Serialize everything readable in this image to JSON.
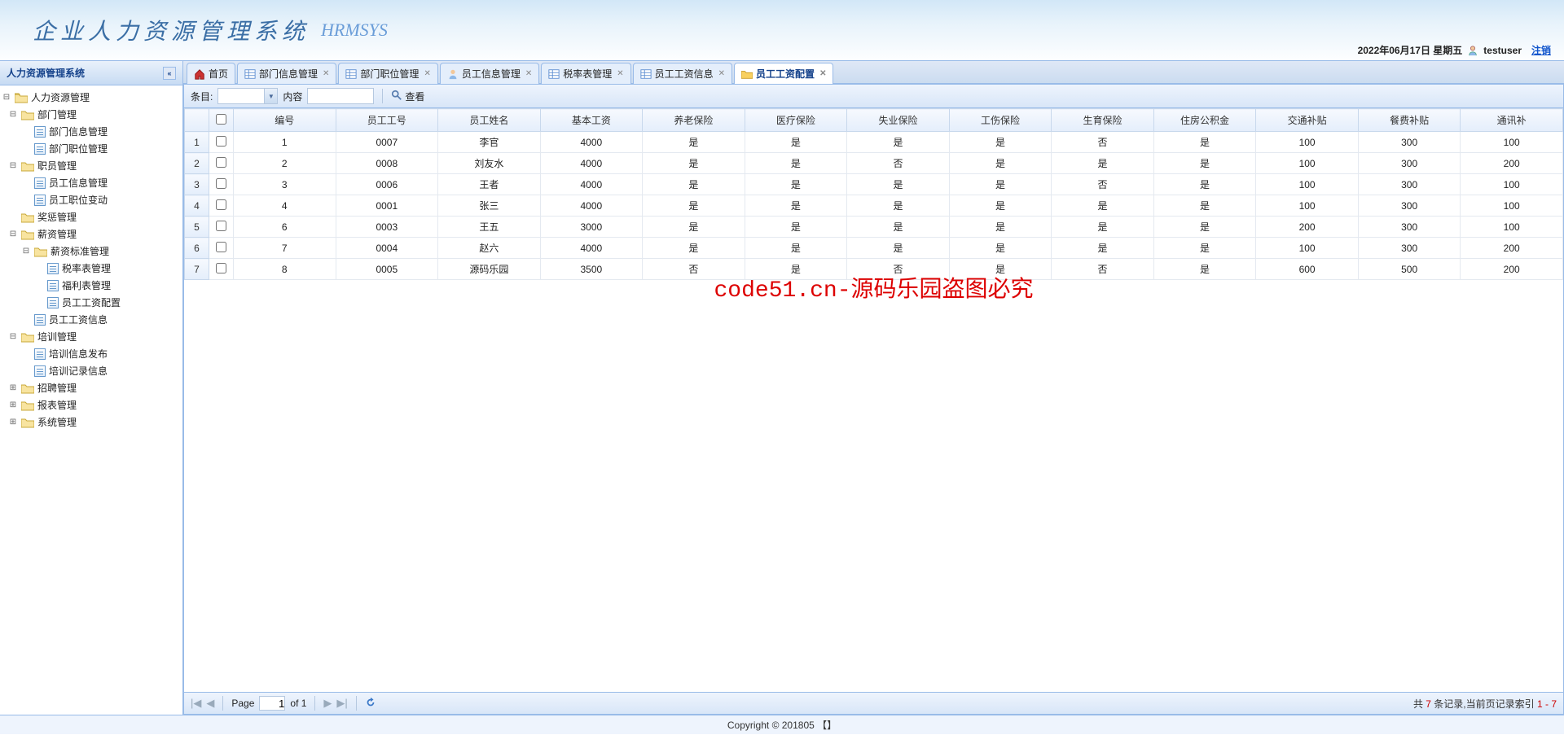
{
  "header": {
    "title": "企业人力资源管理系统",
    "subtitle": "HRMSYS",
    "date_text": "2022年06月17日 星期五",
    "user": "testuser",
    "logout": "注销"
  },
  "sidebar": {
    "title": "人力资源管理系统",
    "root": "人力资源管理",
    "nodes": {
      "dept_mgmt": "部门管理",
      "dept_info": "部门信息管理",
      "dept_pos": "部门职位管理",
      "emp_mgmt": "职员管理",
      "emp_info": "员工信息管理",
      "emp_pos_change": "员工职位变动",
      "reward": "奖惩管理",
      "salary_mgmt": "薪资管理",
      "salary_std": "薪资标准管理",
      "tax_table": "税率表管理",
      "welfare_table": "福利表管理",
      "salary_config": "员工工资配置",
      "salary_info": "员工工资信息",
      "train_mgmt": "培训管理",
      "train_pub": "培训信息发布",
      "train_rec": "培训记录信息",
      "recruit": "招聘管理",
      "report": "报表管理",
      "system": "系统管理"
    }
  },
  "tabs": [
    {
      "label": "首页",
      "icon": "home",
      "closable": false
    },
    {
      "label": "部门信息管理",
      "icon": "grid",
      "closable": true
    },
    {
      "label": "部门职位管理",
      "icon": "grid",
      "closable": true
    },
    {
      "label": "员工信息管理",
      "icon": "person",
      "closable": true
    },
    {
      "label": "税率表管理",
      "icon": "grid",
      "closable": true
    },
    {
      "label": "员工工资信息",
      "icon": "grid",
      "closable": true
    },
    {
      "label": "员工工资配置",
      "icon": "folder",
      "closable": true,
      "active": true
    }
  ],
  "toolbar": {
    "item_label": "条目:",
    "content_label": "内容",
    "view_label": "查看"
  },
  "grid": {
    "columns": [
      "编号",
      "员工工号",
      "员工姓名",
      "基本工资",
      "养老保险",
      "医疗保险",
      "失业保险",
      "工伤保险",
      "生育保险",
      "住房公积金",
      "交通补贴",
      "餐费补贴",
      "通讯补"
    ],
    "rows": [
      {
        "n": "1",
        "id": "1",
        "no": "0007",
        "name": "李官",
        "base": "4000",
        "c1": "是",
        "c2": "是",
        "c3": "是",
        "c4": "是",
        "c5": "否",
        "c6": "是",
        "t1": "100",
        "t2": "300",
        "t3": "100"
      },
      {
        "n": "2",
        "id": "2",
        "no": "0008",
        "name": "刘友水",
        "base": "4000",
        "c1": "是",
        "c2": "是",
        "c3": "否",
        "c4": "是",
        "c5": "是",
        "c6": "是",
        "t1": "100",
        "t2": "300",
        "t3": "200"
      },
      {
        "n": "3",
        "id": "3",
        "no": "0006",
        "name": "王者",
        "base": "4000",
        "c1": "是",
        "c2": "是",
        "c3": "是",
        "c4": "是",
        "c5": "否",
        "c6": "是",
        "t1": "100",
        "t2": "300",
        "t3": "100"
      },
      {
        "n": "4",
        "id": "4",
        "no": "0001",
        "name": "张三",
        "base": "4000",
        "c1": "是",
        "c2": "是",
        "c3": "是",
        "c4": "是",
        "c5": "是",
        "c6": "是",
        "t1": "100",
        "t2": "300",
        "t3": "100"
      },
      {
        "n": "5",
        "id": "6",
        "no": "0003",
        "name": "王五",
        "base": "3000",
        "c1": "是",
        "c2": "是",
        "c3": "是",
        "c4": "是",
        "c5": "是",
        "c6": "是",
        "t1": "200",
        "t2": "300",
        "t3": "100"
      },
      {
        "n": "6",
        "id": "7",
        "no": "0004",
        "name": "赵六",
        "base": "4000",
        "c1": "是",
        "c2": "是",
        "c3": "是",
        "c4": "是",
        "c5": "是",
        "c6": "是",
        "t1": "100",
        "t2": "300",
        "t3": "200"
      },
      {
        "n": "7",
        "id": "8",
        "no": "0005",
        "name": "源码乐园",
        "base": "3500",
        "c1": "否",
        "c2": "是",
        "c3": "否",
        "c4": "是",
        "c5": "否",
        "c6": "是",
        "t1": "600",
        "t2": "500",
        "t3": "200"
      }
    ]
  },
  "watermark": "code51.cn-源码乐园盗图必究",
  "pager": {
    "page_label": "Page",
    "page": "1",
    "of_label": "of 1",
    "summary_prefix": "共 ",
    "total": "7",
    "summary_mid": " 条记录,当前页记录索引 ",
    "range": "1 - 7"
  },
  "footer": "Copyright © 201805 【】"
}
